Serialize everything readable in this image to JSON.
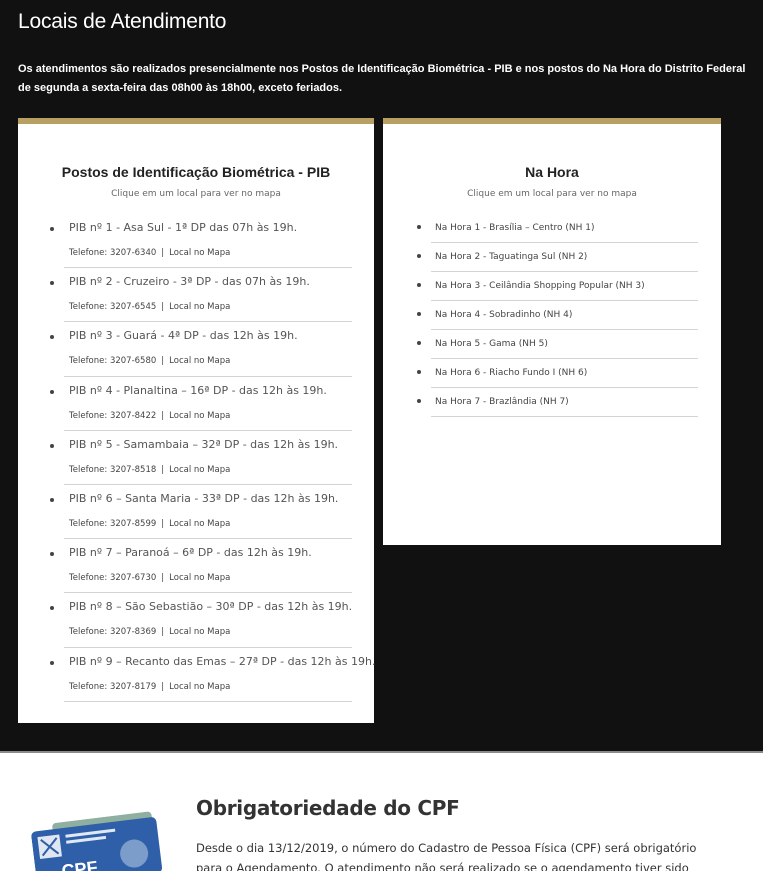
{
  "header": {
    "title": "Locais de Atendimento",
    "intro": "Os atendimentos são realizados presencialmente nos Postos de Identificação Biométrica - PIB e nos postos do Na Hora do Distrito Federal de segunda a sexta-feira das 08h00 às 18h00, exceto feriados."
  },
  "pib": {
    "title": "Postos de Identificação Biométrica - PIB",
    "hint": "Clique em um local para ver no mapa",
    "map_label": "Local no Mapa",
    "separator": "|",
    "items": [
      {
        "name": "PIB nº 1 - Asa Sul - 1ª DP das 07h às 19h.",
        "phone": "Telefone: 3207-6340"
      },
      {
        "name": "PIB nº 2 - Cruzeiro - 3ª DP - das 07h às 19h.",
        "phone": "Telefone: 3207-6545"
      },
      {
        "name": "PIB nº 3 - Guará - 4ª DP - das 12h às 19h.",
        "phone": "Telefone: 3207-6580"
      },
      {
        "name": "PIB nº 4 - Planaltina – 16ª DP - das 12h às 19h.",
        "phone": "Telefone: 3207-8422"
      },
      {
        "name": "PIB nº 5 - Samambaia – 32ª DP - das 12h às 19h.",
        "phone": "Telefone: 3207-8518"
      },
      {
        "name": "PIB nº 6 – Santa Maria - 33ª DP - das 12h às 19h.",
        "phone": "Telefone: 3207-8599"
      },
      {
        "name": "PIB nº 7 – Paranoá – 6ª DP - das 12h às 19h.",
        "phone": "Telefone: 3207-6730"
      },
      {
        "name": "PIB nº 8 – São Sebastião – 30ª DP - das 12h às 19h.",
        "phone": "Telefone: 3207-8369"
      },
      {
        "name": "PIB nº 9 – Recanto das Emas – 27ª DP - das 12h às 19h.",
        "phone": "Telefone: 3207-8179"
      }
    ]
  },
  "nahora": {
    "title": "Na Hora",
    "hint": "Clique em um local para ver no mapa",
    "items": [
      "Na Hora 1 - Brasília – Centro (NH 1)",
      "Na Hora 2 - Taguatinga Sul (NH 2)",
      "Na Hora 3 - Ceilândia Shopping Popular (NH 3)",
      "Na Hora 4 - Sobradinho (NH 4)",
      "Na Hora 5 - Gama (NH 5)",
      "Na Hora 6 - Riacho Fundo I (NH 6)",
      "Na Hora 7 - Brazlândia (NH 7)"
    ]
  },
  "cpf_section": {
    "title": "Obrigatoriedade do CPF",
    "text": "Desde o dia 13/12/2019, o número do Cadastro de Pessoa Física (CPF) será obrigatório para o Agendamento. O atendimento não será realizado se o agendamento tiver sido feito utilizando o",
    "card_label": "CPF"
  },
  "colors": {
    "accent": "#b8a062",
    "dark_bg": "#111111",
    "card_blue": "#2f5fa8"
  }
}
